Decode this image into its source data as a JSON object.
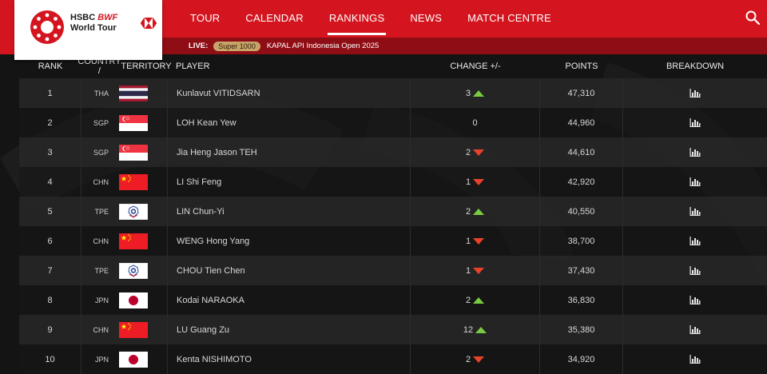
{
  "header": {
    "logo": {
      "line1_a": "HSBC",
      "line1_b": "BWF",
      "line2": "World Tour"
    },
    "nav": [
      {
        "label": "TOUR",
        "active": false
      },
      {
        "label": "CALENDAR",
        "active": false
      },
      {
        "label": "RANKINGS",
        "active": true
      },
      {
        "label": "NEWS",
        "active": false
      },
      {
        "label": "MATCH CENTRE",
        "active": false
      }
    ],
    "search_icon": "search-icon"
  },
  "live": {
    "label": "LIVE:",
    "badge": "Super 1000",
    "event": "KAPAL API Indonesia Open 2025"
  },
  "table": {
    "headers": {
      "rank": "RANK",
      "country_line1": "COUNTRY /",
      "country_line2": "TERRITORY",
      "player": "PLAYER",
      "change": "CHANGE +/-",
      "points": "POINTS",
      "breakdown": "BREAKDOWN"
    },
    "rows": [
      {
        "rank": "1",
        "code": "THA",
        "player": "Kunlavut VITIDSARN",
        "change": "3",
        "dir": "up",
        "points": "47,310"
      },
      {
        "rank": "2",
        "code": "SGP",
        "player": "LOH Kean Yew",
        "change": "0",
        "dir": "none",
        "points": "44,960"
      },
      {
        "rank": "3",
        "code": "SGP",
        "player": "Jia Heng Jason TEH",
        "change": "2",
        "dir": "down",
        "points": "44,610"
      },
      {
        "rank": "4",
        "code": "CHN",
        "player": "LI Shi Feng",
        "change": "1",
        "dir": "down",
        "points": "42,920"
      },
      {
        "rank": "5",
        "code": "TPE",
        "player": "LIN Chun-Yi",
        "change": "2",
        "dir": "up",
        "points": "40,550"
      },
      {
        "rank": "6",
        "code": "CHN",
        "player": "WENG Hong Yang",
        "change": "1",
        "dir": "down",
        "points": "38,700"
      },
      {
        "rank": "7",
        "code": "TPE",
        "player": "CHOU Tien Chen",
        "change": "1",
        "dir": "down",
        "points": "37,430"
      },
      {
        "rank": "8",
        "code": "JPN",
        "player": "Kodai NARAOKA",
        "change": "2",
        "dir": "up",
        "points": "36,830"
      },
      {
        "rank": "9",
        "code": "CHN",
        "player": "LU Guang Zu",
        "change": "12",
        "dir": "up",
        "points": "35,380"
      },
      {
        "rank": "10",
        "code": "JPN",
        "player": "Kenta NISHIMOTO",
        "change": "2",
        "dir": "down",
        "points": "34,920"
      }
    ],
    "breakdown_icon": "bar-chart-icon"
  },
  "colors": {
    "brand_red": "#d4151f",
    "live_bar": "#8f0d14",
    "badge_gold": "#c9a46a",
    "up_green": "#7ac943",
    "down_red": "#e8422a"
  }
}
